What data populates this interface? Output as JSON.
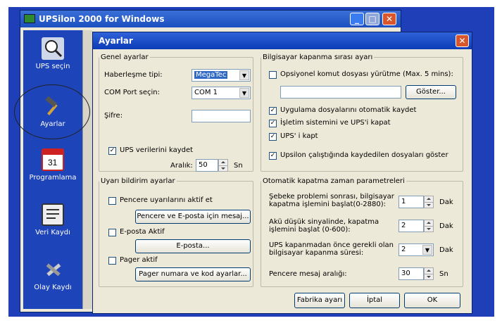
{
  "main_window": {
    "title": "UPSilon 2000 for Windows",
    "minimize": "_",
    "close": "✕"
  },
  "sidebar": {
    "items": [
      {
        "label": "UPS seçin",
        "icon": "magnifier-icon"
      },
      {
        "label": "Ayarlar",
        "icon": "hammer-icon"
      },
      {
        "label": "Programlama",
        "icon": "calendar-icon"
      },
      {
        "label": "Veri Kaydı",
        "icon": "document-icon"
      },
      {
        "label": "Olay Kaydı",
        "icon": "tools-icon"
      }
    ]
  },
  "dialog": {
    "title": "Ayarlar",
    "close": "✕",
    "general": {
      "legend": "Genel ayarlar",
      "protocol_label": "Haberleşme tipi:",
      "protocol_value": "MegaTec",
      "port_label": "COM Port seçin:",
      "port_value": "COM 1",
      "password_label": "Şifre:",
      "password_value": "",
      "save_data_label": "UPS verilerini kaydet",
      "save_data_checked": true,
      "interval_label": "Aralık:",
      "interval_value": "50",
      "interval_unit": "Sn"
    },
    "notify": {
      "legend": "Uyarı bildirim ayarlar",
      "popup_label": "Pencere uyarılarını aktif et",
      "popup_checked": false,
      "popup_button": "Pencere ve E-posta için mesaj...",
      "email_label": "E-posta Aktif",
      "email_checked": false,
      "email_button": "E-posta...",
      "pager_label": "Pager aktif",
      "pager_checked": false,
      "pager_button": "Pager numara ve kod ayarlar..."
    },
    "shutdown_order": {
      "legend": "Bilgisayar kapanma sırası ayarı",
      "optional_cmd_label": "Opsiyonel komut dosyası yürütme (Max. 5 mins):",
      "optional_cmd_checked": false,
      "cmd_value": "",
      "show_button": "Göster...",
      "auto_save_label": "Uygulama dosyalarını otomatik kaydet",
      "auto_save_checked": true,
      "os_ups_label": "İşletim sistemini ve UPS'i kapat",
      "os_ups_checked": true,
      "ups_off_label": "UPS' i kapt",
      "ups_off_checked": true,
      "show_saved_label": "Upsilon çalıştığında kaydedilen dosyaları göster",
      "show_saved_checked": true
    },
    "timing": {
      "legend": "Otomatik kapatma zaman parametreleri",
      "grid_label": "Şebeke problemi sonrası, bilgisayar kapatma işlemini başlat(0-2880):",
      "grid_value": "1",
      "grid_unit": "Dak",
      "battery_label": "Akü düşük sinyalinde, kapatma işlemini başlat (0-600):",
      "battery_value": "2",
      "battery_unit": "Dak",
      "ups_time_label": "UPS kapanmadan önce gerekli olan bilgisayar kapanma süresi:",
      "ups_time_value": "2",
      "ups_time_unit": "Dak",
      "msg_interval_label": "Pencere mesaj aralığı:",
      "msg_interval_value": "30",
      "msg_interval_unit": "Sn"
    },
    "buttons": {
      "defaults": "Fabrika ayarı",
      "cancel": "İptal",
      "ok": "OK"
    }
  }
}
